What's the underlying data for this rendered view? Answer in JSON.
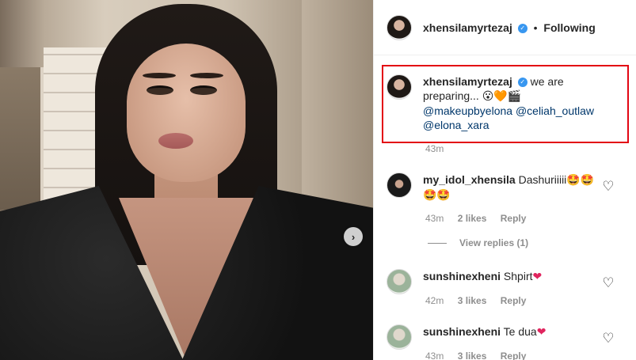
{
  "post": {
    "author": "xhensilamyrtezaj",
    "follow_status": "Following",
    "separator": "•"
  },
  "caption": {
    "username": "xhensilamyrtezaj",
    "text": "we are preparing...",
    "emojis": "😮🧡🎬",
    "mentions": [
      "@makeupbyelona",
      "@celiah_outlaw",
      "@elona_xara"
    ],
    "time": "43m"
  },
  "comments": [
    {
      "username": "my_idol_xhensila",
      "text": "Dashuriiiii",
      "emojis_line1": "🤩🤩",
      "emojis_line2": "🤩🤩",
      "time": "43m",
      "likes": "2 likes",
      "reply": "Reply",
      "view_replies": "View replies (1)"
    },
    {
      "username": "sunshinexheni",
      "text": "Shpirt",
      "emojis": "❤",
      "time": "42m",
      "likes": "3 likes",
      "reply": "Reply"
    },
    {
      "username": "sunshinexheni",
      "text": "Te dua",
      "emojis": "❤",
      "time": "43m",
      "likes": "3 likes",
      "reply": "Reply"
    }
  ],
  "icons": {
    "verified": "verified-badge-icon",
    "like": "heart-outline-icon",
    "next": "chevron-right-icon"
  },
  "colors": {
    "highlight_border": "#e30613",
    "verified": "#3897f0",
    "mention": "#00376b",
    "meta": "#8e8e8e"
  }
}
